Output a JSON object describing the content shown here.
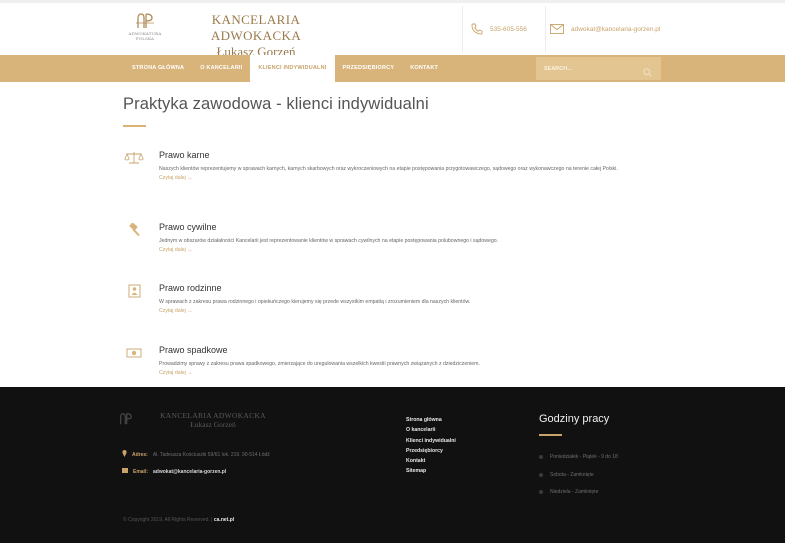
{
  "header": {
    "logo_glyph": "ꭶlℙ",
    "logo_small_line1": "Adwokatura",
    "logo_small_line2": "Polska",
    "brand_line1": "KANCELARIA ADWOKACKA",
    "brand_line2": "Łukasz Gorzeń",
    "phone": "535-605-556",
    "email": "adwokat@kancelaria-gorzen.pl"
  },
  "nav": {
    "items": [
      {
        "label": "STRONA GŁÓWNA",
        "active": false
      },
      {
        "label": "O KANCELARII",
        "active": false
      },
      {
        "label": "KLIENCI INDYWIDUALNI",
        "active": true
      },
      {
        "label": "PRZEDSIĘBIORCY",
        "active": false
      },
      {
        "label": "KONTAKT",
        "active": false
      }
    ],
    "search_placeholder": "SEARCH..."
  },
  "main": {
    "title": "Praktyka zawodowa - klienci indywidualni",
    "read_more": "Czytaj dalej →",
    "practices": [
      {
        "icon": "scales-icon",
        "title": "Prawo karne",
        "text": "Naszych klientów reprezentujemy w sprawach karnych, karnych skarbowych oraz wykroczeniowych na etapie postępowania przygotowawczego, sądowego oraz wykonawczego na terenie całej Polski."
      },
      {
        "icon": "gavel-icon",
        "title": "Prawo cywilne",
        "text": "Jednym w obszarów działalności Kancelarii jest reprezentowanie klientów w sprawach cywilnych na etapie postępowania polubownego i sądowego."
      },
      {
        "icon": "family-icon",
        "title": "Prawo rodzinne",
        "text": "W sprawach z zakresu prawa rodzinnego i opiekuńczego kierujemy się przede wszystkim empatią i zrozumieniem dla naszych klientów."
      },
      {
        "icon": "money-icon",
        "title": "Prawo spadkowe",
        "text": "Prowadzimy sprawy z zakresu prawa spadkowego, zmierzające do uregulowania wszelkich kwestii prawnych związanych z dziedziczeniem."
      }
    ]
  },
  "footer": {
    "brand_line1": "KANCELARIA ADWOKACKA",
    "brand_line2": "Łukasz Gorzeń",
    "address_label": "Adres:",
    "address": "Al. Tadeusza Kościuszki 59/61 lok. 219, 90-514 Łódź",
    "email_label": "Email:",
    "email": "adwokat@kancelaria-gorzen.pl",
    "links": [
      "Strona główna",
      "O kancelarii",
      "Klienci indywidualni",
      "Przedsiębiorcy",
      "Kontakt",
      "Sitemap"
    ],
    "hours_title": "Godziny pracy",
    "hours": [
      "Poniedziałek - Piątek - 9 do 18",
      "Sobota - Zamknięte",
      "Niedziela - Zamknięte"
    ],
    "copyright": "© Copyright 2019. All Rights Reserved. |",
    "copyright_link": "ca.net.pl"
  },
  "colors": {
    "accent": "#d8b47a",
    "accent_text": "#c9a36a",
    "footer_bg": "#111111"
  }
}
